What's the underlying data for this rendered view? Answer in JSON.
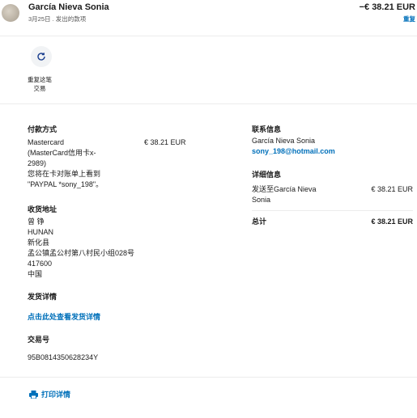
{
  "header": {
    "name": "García Nieva Sonia",
    "subtitle": "3月25日 . 发出的款项",
    "amount": "−€ 38.21 EUR",
    "repeat_link": "重复"
  },
  "actions": {
    "repeat_label_line1": "重复这笔",
    "repeat_label_line2": "交易"
  },
  "payment": {
    "heading": "付款方式",
    "method_lines": [
      "Mastercard",
      "(MasterCard信用卡x-",
      "2989)",
      "您将在卡对账单上看到",
      "\"PAYPAL *sony_198\"。"
    ],
    "amount": "€ 38.21 EUR"
  },
  "shipping": {
    "heading": "收货地址",
    "lines": [
      "曾 铮",
      "HUNAN",
      "新化县",
      "孟公镇孟公村第八村民小组028号",
      "417600",
      "中国"
    ]
  },
  "delivery": {
    "heading": "发货详情",
    "link": "点击此处查看发货详情"
  },
  "transaction": {
    "heading": "交易号",
    "id": "95B0814350628234Y"
  },
  "contact": {
    "heading": "联系信息",
    "name": "García Nieva Sonia",
    "email": "sony_198@hotmail.com"
  },
  "details": {
    "heading": "详细信息",
    "line1": "发送至García Nieva",
    "line2": "Sonia",
    "amount": "€ 38.21 EUR",
    "total_label": "总计",
    "total_amount": "€ 38.21 EUR"
  },
  "footer": {
    "print_label": "打印详情"
  }
}
